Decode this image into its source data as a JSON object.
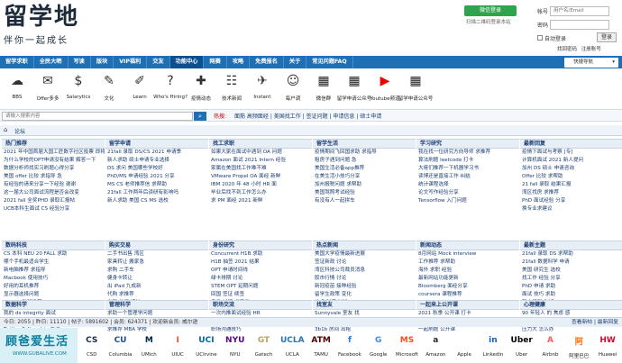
{
  "header": {
    "logo_text": "留学地",
    "slogan": "伴你一起成长",
    "wechat_button": "微信登录",
    "qr_tip": "扫描二维码登录本站",
    "account_label": "帐号",
    "account_placeholder": "用户名/Email",
    "password_label": "密码",
    "auto_login": "自动登录",
    "login_button": "登录",
    "forgot_password": "找回密码",
    "register": "注册账号"
  },
  "nav": {
    "items": [
      "留学求职",
      "全民大晒",
      "写读",
      "版块",
      "VIP福利",
      "交友",
      "功能中心",
      "网赛",
      "攻略",
      "免费报名",
      "关于",
      "常见问题FAQ"
    ],
    "active_index": 6,
    "quick_nav": "快捷导航"
  },
  "icons": [
    {
      "label": "BBS",
      "icon": "forum-icon"
    },
    {
      "label": "Offer多多",
      "icon": "offer-icon"
    },
    {
      "label": "Salarytics",
      "icon": "salary-icon"
    },
    {
      "label": "文化",
      "icon": "culture-icon"
    },
    {
      "label": "Learn",
      "icon": "learn-icon"
    },
    {
      "label": "Who's Hiring?",
      "icon": "hiring-icon"
    },
    {
      "label": "疫情动态",
      "icon": "covid-icon"
    },
    {
      "label": "技术新闻",
      "icon": "news-icon"
    },
    {
      "label": "Instant",
      "icon": "instant-icon"
    },
    {
      "label": "每户调",
      "icon": "survey-icon"
    },
    {
      "label": "微信群",
      "icon": "wechat-group-icon"
    },
    {
      "label": "留学申请公众号",
      "icon": "wechat-official-icon"
    },
    {
      "label": "Youtube频道",
      "icon": "youtube-icon"
    },
    {
      "label": "留学申请公众号",
      "icon": "wechat-official-icon"
    }
  ],
  "search": {
    "placeholder": "请输入搜索内容",
    "hot_label": "热搜:",
    "hot_links": "面筋 高频面经 | 美国找工作 | 签证问题 | 申请信息 | 硕士申请"
  },
  "forum": {
    "name": "论坛"
  },
  "sections": [
    {
      "title": "热门推荐",
      "lines": [
        "2021 年中国首届大国工匠数字社区投票 即将截止",
        "为什么学校的OPT申请没有结果 解答一下",
        "数据分析师找实习刷题心得分享",
        "美国 offer 比较 求指导 急",
        "有经验的请来分享一下经验 谢谢",
        "这一届大公司面试流程是否会改变",
        "2021 fall 全奖PHD 录取汇报帖",
        "UCB本科生面试 CS 经验分享"
      ]
    },
    {
      "title": "留学申请",
      "lines": [
        "21fall 录取 DS/CS 2021 申请季",
        "新人求助 硕士申请专业选择",
        "DS 求问 美国哪些学校好",
        "PhD/MS 申请经验 2021 分享",
        "MS CS 老师推荐信 求帮助",
        "21fall 工作两年后读研有影响吗",
        "新人求助 美国 CS MS 选校"
      ]
    },
    {
      "title": "找工求职",
      "lines": [
        "如果大家在面试中遇到 OA 问题",
        "Amazon 面试 2021 Intern 经验",
        "家属在美国找工作难不难",
        "VMware Propel OA 面经 新鲜",
        "IBM 2020 年 48 小时 HR 面",
        "毕业后找不到工作怎么办",
        "求 PM 面经 2021 新鲜"
      ]
    },
    {
      "title": "留学生活",
      "lines": [
        "疫情期间飞回国求助 求指导",
        "租房子遇到问题 急",
        "美国生活必备app推荐",
        "在美生活小技巧分享",
        "加州报税问题 求帮助",
        "美国驾照考试经验",
        "有没有人一起拼车"
      ]
    },
    {
      "title": "学习研究",
      "lines": [
        "我在找一位研究方向导师 求推荐",
        "算法刷题 leetcode 打卡",
        "大佬们推荐一下机器学习书",
        "读博还是直接工作 纠结",
        "统计课程选择",
        "论文写作经验分享",
        "Tensorflow 入门问题"
      ]
    },
    {
      "title": "最新回复",
      "lines": [
        "疫情下面试与考察 [专]",
        "计算机面试 2021 新人提问",
        "加州 DS 硕士 申请咨询",
        "Offer 比较 求帮助",
        "21 fall 录取 结果汇报",
        "湾区找房 求推荐",
        "PhD 面试经验 分享",
        "换专业求建议"
      ]
    },
    {
      "title": "数码科技",
      "lines": [
        "CS 本科 NEU 20 FALL 求助",
        "哪个手机最适合学生",
        "新电脑推荐 求指导",
        "Macbook 使用技巧",
        "好用的耳机推荐",
        "显示器选择问题",
        "Switch 游戏推荐"
      ]
    },
    {
      "title": "购买交易",
      "lines": [
        "二手书出售 湾区",
        "家具转让 搬家急",
        "求购 二手车",
        "健身卡转让",
        "出 iPad 九成新",
        "代购 求推荐",
        "出租 单间 近校"
      ]
    },
    {
      "title": "身份研究",
      "lines": [
        "Concurrent H1B 求助",
        "H1B 抽签 2021 结果",
        "OPT 申请时间线",
        "绿卡排期 讨论",
        "STEM OPT 延期问题",
        "回国 签证 续签",
        "身份 过渡 求建议"
      ]
    },
    {
      "title": "热点新闻",
      "lines": [
        "美国大学疫情最新进展",
        "签证新政 讨论",
        "湾区科技公司裁员消息",
        "股市行情 讨论",
        "新冠疫苗 接种经验",
        "留学生政策 变化",
        "热点 时事 讨论"
      ]
    },
    {
      "title": "新闻动态",
      "lines": [
        "8月网站 Mock interview",
        "工作推荐 求帮助",
        "海外 求职 经验",
        "最新网站功能更新",
        "Bloomberg 面经分享",
        "coursera 课程推荐"
      ]
    },
    {
      "title": "最新主题",
      "lines": [
        "21fall 录取 DS 求帮助",
        "21fall 数据科学 申请",
        "美国 研究生 选校",
        "找工作 经验 分享",
        "PhD 申请 求助",
        "面试 技巧 求助",
        "新人报到 你好"
      ]
    },
    {
      "title": "数据科学",
      "lines": [
        "我的 ds integrity 面试",
        "数据科学家面试经验",
        "Twitter Fellowship 面试"
      ]
    },
    {
      "title": "管理科学",
      "lines": [
        "求助一个管理学问题",
        "MBA 申请经验分享",
        "求推荐 MBA 学校"
      ]
    },
    {
      "title": "职场交流",
      "lines": [
        "一次内推面试经验 HR",
        "新人入职 注意事项",
        "职场沟通技巧"
      ]
    },
    {
      "title": "找室友",
      "lines": [
        "Sunnyvale 室友 找",
        "UChicago 附近 租房",
        "3b1b 房间 出租"
      ]
    },
    {
      "title": "一起来上公开课",
      "lines": [
        "2021 秋季 公开课 打卡",
        "Coursera 学习小组",
        "一起刷题 公开课"
      ]
    },
    {
      "title": "心理健康",
      "lines": [
        "90 年轻人 的 焦虑 感",
        "心理咨询 求推荐",
        "压力大 怎么办"
      ]
    }
  ],
  "stats": {
    "left": "今日: 2055 | 昨日: 11110 | 帖子: 5891602 | 会员: 624371 | 欢迎新会员: 威尔逊",
    "right": "查看新帖 | 最新回复"
  },
  "logos": {
    "sponsor_title": "顾爸爱生活",
    "sponsor_sub": "WWW.GUBALIVE.COM",
    "items": [
      {
        "name": "CSD",
        "mark": "CS",
        "color": "#182B49"
      },
      {
        "name": "Columbia",
        "mark": "CU",
        "color": "#1D4F91"
      },
      {
        "name": "UMich",
        "mark": "M",
        "color": "#00274C"
      },
      {
        "name": "UIUC",
        "mark": "I",
        "color": "#E84A27"
      },
      {
        "name": "UCIrvine",
        "mark": "UCI",
        "color": "#0064A4"
      },
      {
        "name": "NYU",
        "mark": "NYU",
        "color": "#57068C"
      },
      {
        "name": "Gatech",
        "mark": "GT",
        "color": "#B3A369"
      },
      {
        "name": "UCLA",
        "mark": "UCLA",
        "color": "#2774AE"
      },
      {
        "name": "TAMU",
        "mark": "ATM",
        "color": "#500000"
      },
      {
        "name": "Facebook",
        "mark": "f",
        "color": "#1877F2"
      },
      {
        "name": "Google",
        "mark": "G",
        "color": "#4285F4"
      },
      {
        "name": "Microsoft",
        "mark": "MS",
        "color": "#F25022"
      },
      {
        "name": "Amazon",
        "mark": "a",
        "color": "#232F3E"
      },
      {
        "name": "Apple",
        "mark": "",
        "color": "#888888"
      },
      {
        "name": "Linkedin",
        "mark": "in",
        "color": "#0A66C2"
      },
      {
        "name": "Uber",
        "mark": "Uber",
        "color": "#000000"
      },
      {
        "name": "Airbnb",
        "mark": "A",
        "color": "#FF5A5F"
      },
      {
        "name": "阿里巴巴",
        "mark": "阿",
        "color": "#FF6A00"
      },
      {
        "name": "Huawei",
        "mark": "HW",
        "color": "#CF0A2C"
      }
    ]
  }
}
